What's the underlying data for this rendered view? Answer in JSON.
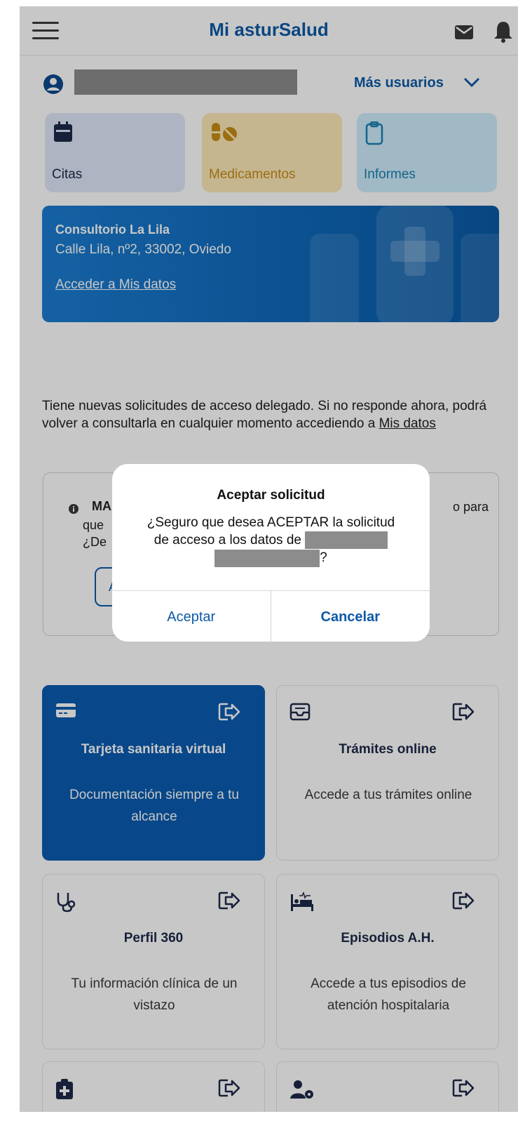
{
  "header": {
    "title": "Mi asturSalud"
  },
  "user_bar": {
    "more_users_label": "Más usuarios"
  },
  "tiles": [
    {
      "label": "Citas",
      "icon": "calendar-icon"
    },
    {
      "label": "Medicamentos",
      "icon": "pills-icon"
    },
    {
      "label": "Informes",
      "icon": "clipboard-icon"
    }
  ],
  "banner": {
    "name": "Consultorio La Lila",
    "address": "Calle Lila, nº2, 33002, Oviedo",
    "link": "Acceder a Mis datos"
  },
  "notice": {
    "text": "Tiene nuevas solicitudes de acceso delegado. Si no responde ahora, podrá volver a consultarla en cualquier momento accediendo a ",
    "link": "Mis datos"
  },
  "request_card": {
    "title_fragment": "MA",
    "line2_fragment": "que",
    "line3_fragment": "¿De",
    "right_fragment": "o para",
    "button_fragment": "A"
  },
  "modal": {
    "title": "Aceptar solicitud",
    "line1": "¿Seguro que desea ACEPTAR la solicitud",
    "line2": "de acceso a los datos de ",
    "line3_tail": "?",
    "accept": "Aceptar",
    "cancel": "Cancelar"
  },
  "cards": [
    {
      "title": "Tarjeta sanitaria virtual",
      "desc": "Documentación siempre a tu alcance",
      "icon": "card-icon"
    },
    {
      "title": "Trámites online",
      "desc": "Accede a tus trámites online",
      "icon": "inbox-icon"
    },
    {
      "title": "Perfil 360",
      "desc": "Tu información clínica de un vistazo",
      "icon": "stethoscope-icon"
    },
    {
      "title": "Episodios A.H.",
      "desc": "Accede a tus episodios de atención hospitalaria",
      "icon": "hospital-bed-icon"
    }
  ],
  "colors": {
    "brand": "#0d5aa7",
    "primary_card": "#0b5bb0"
  }
}
